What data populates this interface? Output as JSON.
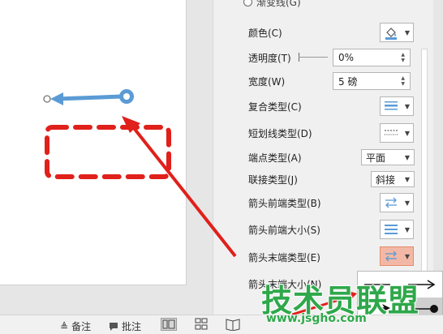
{
  "pane": {
    "gradient_line_label": "渐变线(G)",
    "color_label": "颜色(C)",
    "transparency_label": "透明度(T)",
    "transparency_value": "0%",
    "width_label": "宽度(W)",
    "width_value": "5 磅",
    "compound_type_label": "复合类型(C)",
    "dash_type_label": "短划线类型(D)",
    "cap_type_label": "端点类型(A)",
    "cap_type_value": "平面",
    "join_type_label": "联接类型(J)",
    "join_type_value": "斜接",
    "begin_arrow_type_label": "箭头前端类型(B)",
    "begin_arrow_size_label": "箭头前端大小(S)",
    "end_arrow_type_label": "箭头末端类型(E)",
    "end_arrow_size_label": "箭头末端大小(N)"
  },
  "status_bar": {
    "notes_label": "备注",
    "comments_label": "批注"
  },
  "watermark": {
    "text": "技术员联盟",
    "url": "www.jsgho.com"
  },
  "colors": {
    "accent_blue": "#5b9bd5",
    "highlight_red": "#e0201b",
    "active_button": "#f3b8a5",
    "watermark_green": "#2ea84a"
  }
}
